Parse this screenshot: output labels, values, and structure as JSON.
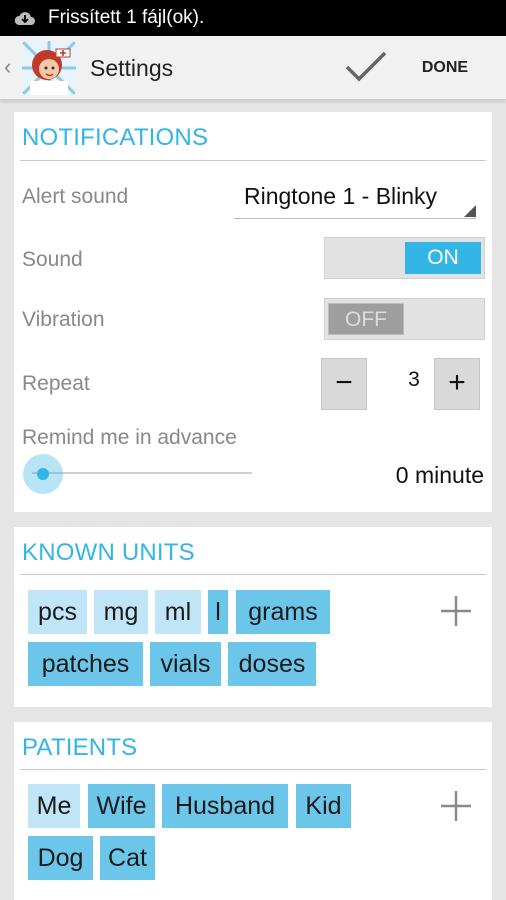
{
  "status_bar": {
    "text": "Frissített 1 fájl(ok)."
  },
  "action_bar": {
    "back_icon": "caret-left-icon",
    "title": "Settings",
    "confirm_icon": "check-icon",
    "done_label": "DONE"
  },
  "notifications": {
    "title": "NOTIFICATIONS",
    "alert_sound_label": "Alert sound",
    "alert_sound_value": "Ringtone 1 - Blinky",
    "sound_label": "Sound",
    "sound_toggle": "ON",
    "vibration_label": "Vibration",
    "vibration_toggle": "OFF",
    "repeat_label": "Repeat",
    "repeat_minus": "−",
    "repeat_value": "3",
    "repeat_plus": "+",
    "remind_label": "Remind me in advance",
    "remind_value": "0 minute",
    "remind_slider_fraction": 0
  },
  "known_units": {
    "title": "KNOWN UNITS",
    "chips": [
      "pcs",
      "mg",
      "ml",
      "l",
      "grams",
      "patches",
      "vials",
      "doses"
    ]
  },
  "patients": {
    "title": "PATIENTS",
    "chips": [
      "Me",
      "Wife",
      "Husband",
      "Kid",
      "Dog",
      "Cat"
    ]
  },
  "colors": {
    "accent": "#33b5e5",
    "chip": "#6cc6ea",
    "chip_light": "#bfe5f6"
  }
}
